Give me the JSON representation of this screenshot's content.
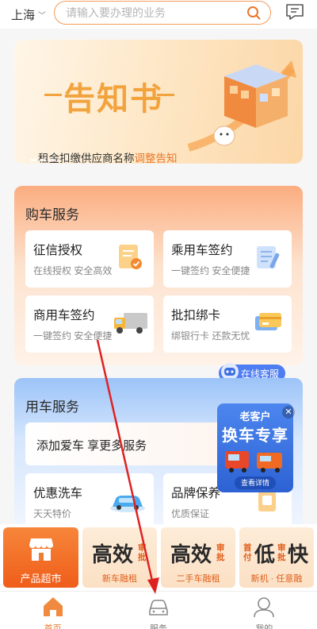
{
  "topbar": {
    "city": "上海",
    "search_placeholder": "请输入要办理的业务"
  },
  "banner": {
    "title": "告知书",
    "subtitle_prefix": "租金扣缴供应商名称",
    "subtitle_highlight": "调整告知"
  },
  "buy_service": {
    "title": "购车服务",
    "cards": [
      {
        "title": "征信授权",
        "sub": "在线授权  安全高效",
        "icon": "document-check-icon"
      },
      {
        "title": "乘用车签约",
        "sub": "一键签约  安全便捷",
        "icon": "contract-icon"
      },
      {
        "title": "商用车签约",
        "sub": "一键签约  安全便捷",
        "icon": "truck-icon"
      },
      {
        "title": "批扣绑卡",
        "sub": "绑银行卡  还款无忧",
        "icon": "bank-card-icon"
      }
    ]
  },
  "customer_service": {
    "label": "在线客服"
  },
  "use_service": {
    "title": "用车服务",
    "add_car": "添加爱车  享更多服务",
    "cards": [
      {
        "title": "优惠洗车",
        "sub": "天天特价",
        "icon": "car-wash-icon"
      },
      {
        "title": "品牌保养",
        "sub": "优质保证",
        "icon": "maintenance-icon"
      }
    ]
  },
  "promo": {
    "line1": "老客户",
    "line2": "换车专享",
    "button": "查看详情"
  },
  "products": {
    "shop_label": "产品超市",
    "items": [
      {
        "big": "高效",
        "small": "审批",
        "label": "新车融租"
      },
      {
        "big": "高效",
        "small": "审批",
        "label": "二手车融租"
      },
      {
        "pre": "首付",
        "big": "低",
        "small": "审批",
        "big2": "快",
        "label": "新机 · 任意融"
      }
    ]
  },
  "nav": {
    "home": "首页",
    "service": "服务",
    "mine": "我的"
  },
  "colors": {
    "accent": "#e8772b",
    "buy_section": "#fbad80",
    "use_section": "#9cc3f8"
  }
}
